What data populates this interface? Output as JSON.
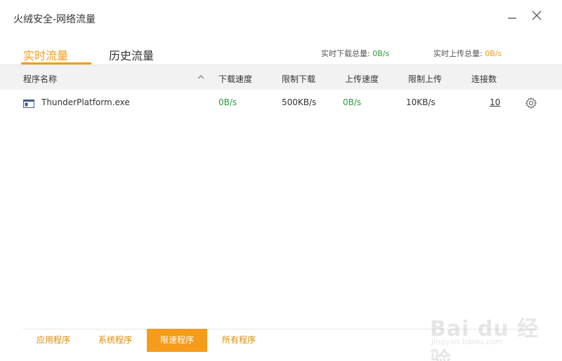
{
  "window": {
    "title": "火绒安全-网络流量"
  },
  "tabs": {
    "realtime": "实时流量",
    "history": "历史流量"
  },
  "summary": {
    "download_label": "实时下载总量:",
    "download_value": "0B/s",
    "upload_label": "实时上传总量:",
    "upload_value": "0B/s"
  },
  "table": {
    "headers": [
      "程序名称",
      "下载速度",
      "限制下载",
      "上传速度",
      "限制上传",
      "连接数"
    ],
    "rows": [
      {
        "program": "ThunderPlatform.exe",
        "download_speed": "0B/s",
        "download_limit": "500KB/s",
        "upload_speed": "0B/s",
        "upload_limit": "10KB/s",
        "connections": "10"
      }
    ]
  },
  "footer_tabs": [
    "应用程序",
    "系统程序",
    "限速程序",
    "所有程序"
  ],
  "watermark": {
    "logo": "Bai du 经验",
    "url": "jingyan.baidu.com"
  },
  "colors": {
    "accent": "#f39c12",
    "speed_green": "#2a9d3a",
    "active_tab_bg": "#f59c1a"
  },
  "icons": [
    "minimize-icon",
    "close-icon",
    "sort-up-icon",
    "app-window-icon",
    "settings-gear-icon"
  ]
}
